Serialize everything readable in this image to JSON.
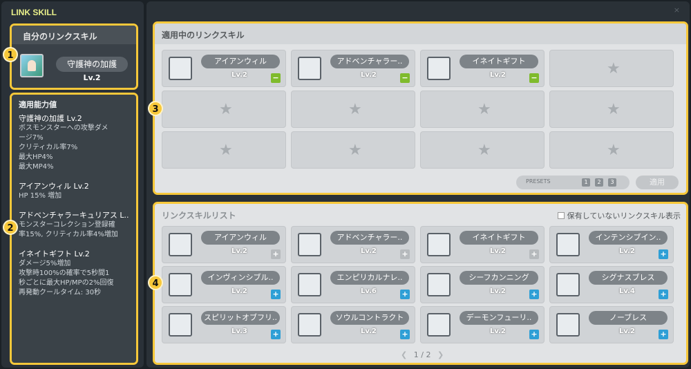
{
  "app": {
    "title": "LINK SKILL",
    "close_label": "×"
  },
  "my_skill": {
    "header": "自分のリンクスキル",
    "name": "守護神の加護",
    "level": "Lv.2"
  },
  "stats": {
    "header": "適用能力値",
    "groups": [
      {
        "name": "守護神の加護 Lv.2",
        "lines": [
          "ボスモンスターへの攻撃ダメ",
          "ージ7%",
          "クリティカル率7%",
          "最大HP4%",
          "最大MP4%"
        ]
      },
      {
        "name": "アイアンウィル Lv.2",
        "lines": [
          "HP 15% 増加"
        ]
      },
      {
        "name": "アドベンチャラーキュリアス L..",
        "lines": [
          "モンスターコレクション登録確",
          "率15%, クリティカル率4%増加"
        ]
      },
      {
        "name": "イネイトギフト Lv.2",
        "lines": [
          "ダメージ5%増加",
          "攻撃時100%の確率で5秒間1",
          "秒ごとに最大HP/MPの2%回復",
          "再発動クールタイム: 30秒"
        ]
      }
    ]
  },
  "applied": {
    "header": "適用中のリンクスキル",
    "slots": [
      {
        "name": "アイアンウィル",
        "level": "Lv.2",
        "icon": "iron-will-icon"
      },
      {
        "name": "アドベンチャラー..",
        "level": "Lv.2",
        "icon": "adventurer-icon"
      },
      {
        "name": "イネイトギフト",
        "level": "Lv.2",
        "icon": "innate-gift-icon"
      }
    ],
    "presets_label": "PRESETS",
    "presets": [
      "1",
      "2",
      "3"
    ],
    "apply_label": "適用"
  },
  "list": {
    "header": "リンクスキルリスト",
    "show_unowned_label": "保有していないリンクスキル表示",
    "items": [
      {
        "name": "アイアンウィル",
        "level": "Lv.2",
        "state": "disabled",
        "icon": "iron-will-icon"
      },
      {
        "name": "アドベンチャラー..",
        "level": "Lv.2",
        "state": "disabled",
        "icon": "adventurer-icon"
      },
      {
        "name": "イネイトギフト",
        "level": "Lv.2",
        "state": "disabled",
        "icon": "innate-gift-icon"
      },
      {
        "name": "インテンシブイン..",
        "level": "Lv.2",
        "state": "add",
        "icon": "intensive-insult-icon"
      },
      {
        "name": "インヴィンシブル..",
        "level": "Lv.2",
        "state": "add",
        "icon": "invincible-belief-icon"
      },
      {
        "name": "エンピリカルナレ..",
        "level": "Lv.6",
        "state": "add",
        "icon": "empirical-knowledge-icon"
      },
      {
        "name": "シーフカンニング",
        "level": "Lv.2",
        "state": "add",
        "icon": "thief-cunning-icon"
      },
      {
        "name": "シグナスブレス",
        "level": "Lv.4",
        "state": "add",
        "icon": "cygnus-blessing-icon"
      },
      {
        "name": "スピリットオブフリ..",
        "level": "Lv.3",
        "state": "add",
        "icon": "spirit-of-freedom-icon"
      },
      {
        "name": "ソウルコントラクト",
        "level": "Lv.2",
        "state": "add",
        "icon": "soul-contract-icon"
      },
      {
        "name": "デーモンフューリ..",
        "level": "Lv.2",
        "state": "add",
        "icon": "demon-fury-icon"
      },
      {
        "name": "ノーブレス",
        "level": "Lv.2",
        "state": "add",
        "icon": "noblesse-icon"
      }
    ],
    "page_current": "1",
    "page_sep": "/",
    "page_total": "2"
  },
  "callouts": [
    "1",
    "2",
    "3",
    "4"
  ],
  "colors": {
    "highlight": "#f7c83a",
    "plus_button": "#2e9fd6",
    "minus_button": "#7fbb2c"
  }
}
